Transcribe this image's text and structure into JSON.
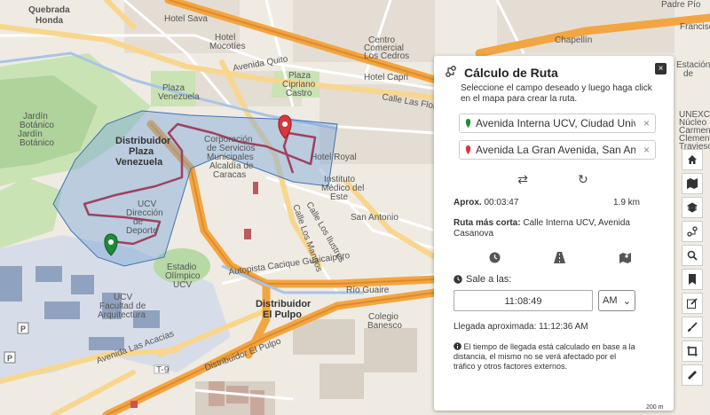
{
  "map": {
    "labels": {
      "quebrada_honda": "Quebrada\nHonda",
      "hotel_savoy": "Hotel Sava",
      "hotel_mocotíes": "Hotel\nMocotíes",
      "centro_comercial": "Centro\nComercial\nLos Cedros",
      "chapellin": "Chapellín",
      "padre_pio": "Padre Pío",
      "avenida_quito": "Avenida Quito",
      "plaza_cipriano": "Plaza\nCipriano\nCastro",
      "hotel_capri": "Hotel Capri",
      "calle_las_flores": "Calle Las Flores",
      "jardin_botanico": "Jardín\nBotánico",
      "plaza_venezuela": "Distribuidor\nPlaza\nVenezuela",
      "plaza_venezuela_top": "Plaza\nVenezuela",
      "corporacion": "Corporación\nde Servicios\nMunicipales\nAlcaldía de\nCaracas",
      "hotel_royal": "Hotel Royal",
      "instituto_medico": "Instituto\nMédico del\nEste",
      "san_antonio": "San Antonio",
      "ucv_direccion": "UCV\nDirección\nde\nDeporte",
      "estadio": "Estadio\nOlímpico\nUCV",
      "ucv_arquitectura": "UCV\nFacultad de\nArquitectura",
      "distribuidor_pulpo": "Distribuidor\nEl Pulpo",
      "autopista": "Autopista Cacique Guaicaipuro",
      "los_guaire": "Río Guaire",
      "avenida_acacias": "Avenida Las Acacias",
      "colegio_banesco": "Colegio\nBanesco",
      "francisco": "Francisco",
      "acacias_left": "Avenida Las Acacias",
      "unexca": "UNEXCA\nNúcleo\nCarmen\nClemente\nTravieso\nde Caracas",
      "estacion": "Estación\nde",
      "t9": "T-9",
      "distribuidor_pulpo_road": "Distribuidor El Pulpo",
      "calle_los_mangos": "Calle Los Mangos",
      "calle_los_ilustres": "Calle Los Ilustres",
      "avenida_interna": "Avenida Las Acacias"
    },
    "scale_text": "200 m"
  },
  "panel": {
    "title": "Cálculo de Ruta",
    "description": "Seleccione el campo deseado y luego haga click en el mapa para crear la ruta.",
    "origin_value": "Avenida Interna UCV, Ciudad Univers",
    "destination_value": "Avenida La Gran Avenida, San Anton",
    "clear_symbol": "×",
    "approx_label": "Aprox.",
    "approx_time": "00:03:47",
    "distance": "1.9 km",
    "shortest_label": "Ruta más corta:",
    "shortest_route": "Calle Interna UCV, Avenida Casanova",
    "depart_label": "Sale a las:",
    "depart_time": "11:08:49",
    "ampm": "AM",
    "arrival_text": "Llegada aproximada: 11:12:36 AM",
    "note": "El tiempo de llegada está calculado en base a la distancia, el mismo no se verá afectado por el tráfico y otros factores externos.",
    "close_symbol": "×"
  },
  "toolbar": {
    "items": [
      "home-icon",
      "map-icon",
      "layers-icon",
      "route-icon",
      "zoom-search-icon",
      "bookmark-icon",
      "edit-icon",
      "brush-icon",
      "crop-icon",
      "ruler-icon"
    ]
  },
  "colors": {
    "route_fill": "#7aa6d6",
    "route_line": "#a04060",
    "motorway": "#f2a541",
    "primary": "#f9d68e",
    "origin_marker": "#1e8a3a",
    "destination_marker": "#d9363e"
  }
}
